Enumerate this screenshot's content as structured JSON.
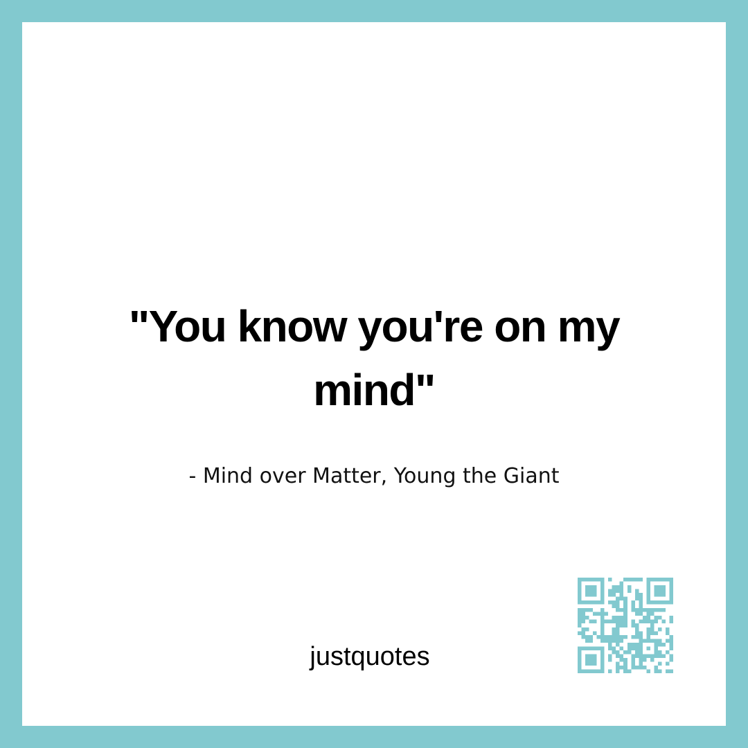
{
  "quote": {
    "text": "\"You know you're on my mind\"",
    "attribution": "- Mind over Matter, Young the Giant"
  },
  "brand": {
    "name": "justquotes"
  },
  "qr_code": {
    "icon": "qr-code-icon",
    "color": "#82c9cf"
  },
  "colors": {
    "frame": "#82c9cf",
    "background": "#ffffff",
    "text": "#000000"
  }
}
